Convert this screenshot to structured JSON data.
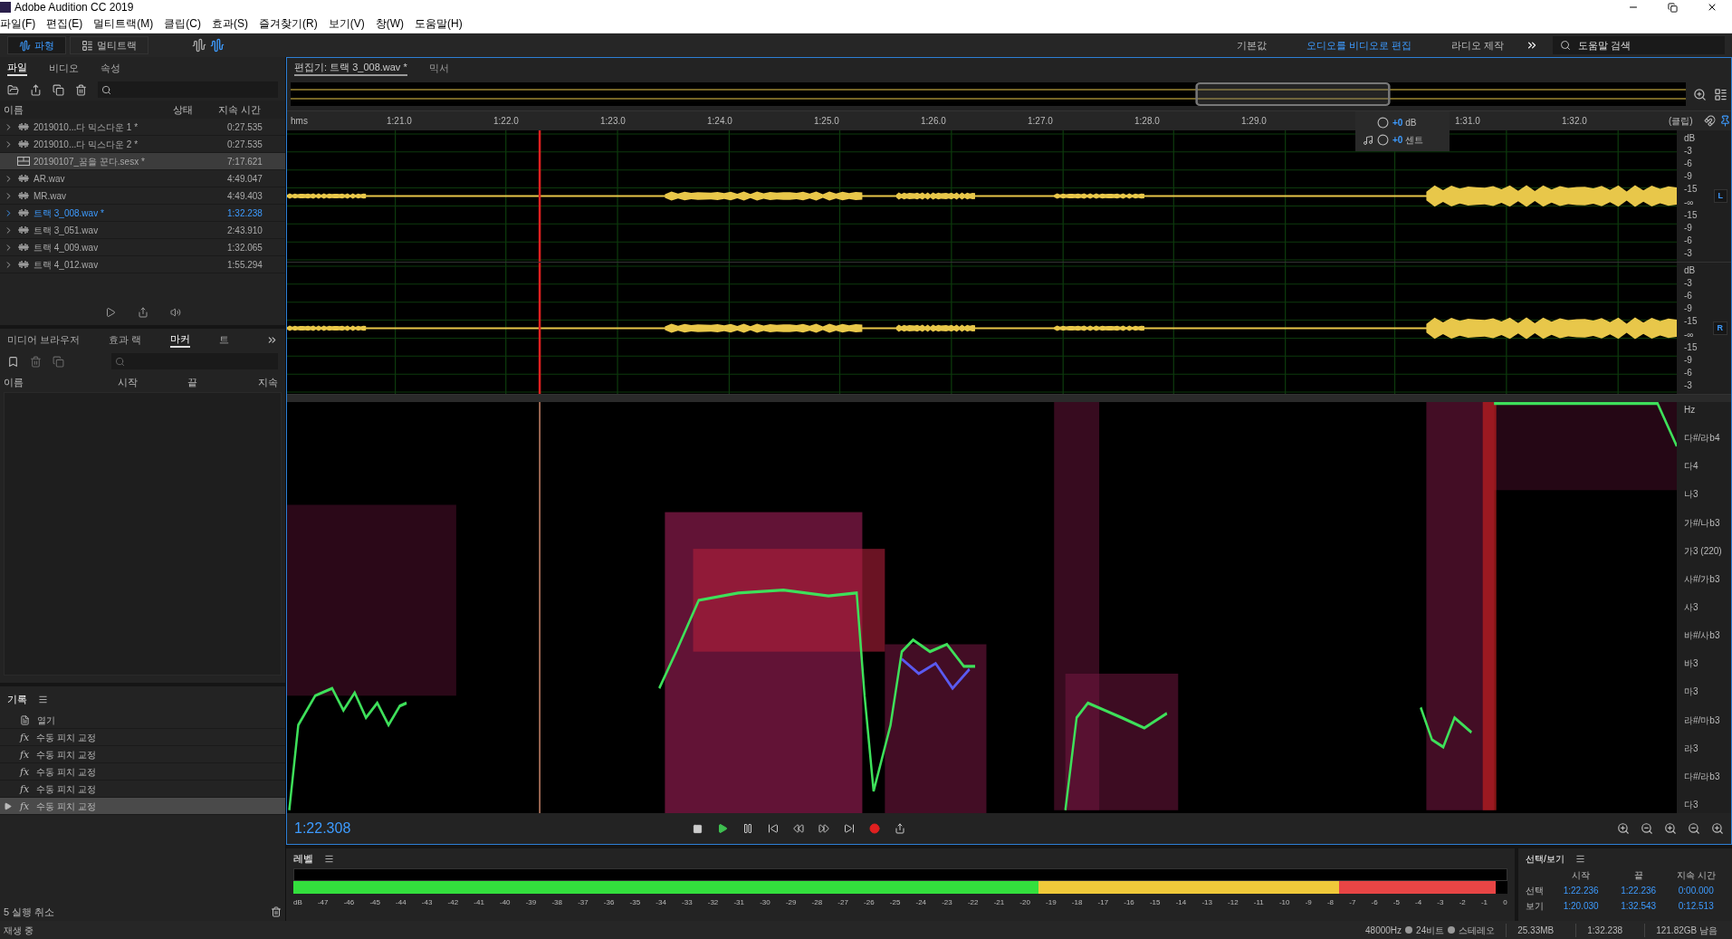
{
  "window": {
    "title": "Adobe Audition CC 2019"
  },
  "menu": [
    "파일(F)",
    "편집(E)",
    "멀티트랙(M)",
    "클립(C)",
    "효과(S)",
    "즐겨찾기(R)",
    "보기(V)",
    "창(W)",
    "도움말(H)"
  ],
  "modes": [
    {
      "label": "파형",
      "kind": "waveform",
      "selected": true
    },
    {
      "label": "멀티트랙",
      "kind": "multitrack",
      "selected": false
    }
  ],
  "workspaces": [
    {
      "label": "기본값",
      "selected": false
    },
    {
      "label": "오디오를 비디오로 편집",
      "selected": true
    },
    {
      "label": "라디오 제작",
      "selected": false
    }
  ],
  "help_search": {
    "placeholder": "도움말 검색"
  },
  "files_panel": {
    "tabs": [
      {
        "label": "파일",
        "selected": true
      },
      {
        "label": "비디오",
        "selected": false
      },
      {
        "label": "속성",
        "selected": false
      }
    ],
    "columns": [
      "이름",
      "상태",
      "지속 시간"
    ],
    "rows": [
      {
        "name": "2019010...다 믹스다운 1 *",
        "duration": "0:27.535",
        "kind": "audio",
        "selected": false,
        "open": false
      },
      {
        "name": "2019010...다 믹스다운 2 *",
        "duration": "0:27.535",
        "kind": "audio",
        "selected": false,
        "open": false
      },
      {
        "name": "20190107_꿈을 꾼다.sesx *",
        "duration": "7:17.621",
        "kind": "session",
        "selected": true,
        "open": false
      },
      {
        "name": "AR.wav",
        "duration": "4:49.047",
        "kind": "audio",
        "selected": false,
        "open": false
      },
      {
        "name": "MR.wav",
        "duration": "4:49.403",
        "kind": "audio",
        "selected": false,
        "open": false
      },
      {
        "name": "트랙 3_008.wav *",
        "duration": "1:32.238",
        "kind": "audio",
        "selected": false,
        "open": true
      },
      {
        "name": "트랙 3_051.wav",
        "duration": "2:43.910",
        "kind": "audio",
        "selected": false,
        "open": false
      },
      {
        "name": "트랙 4_009.wav",
        "duration": "1:32.065",
        "kind": "audio",
        "selected": false,
        "open": false
      },
      {
        "name": "트랙 4_012.wav",
        "duration": "1:55.294",
        "kind": "audio",
        "selected": false,
        "open": false
      }
    ]
  },
  "marker_panel": {
    "tabs": [
      {
        "label": "미디어 브라우저",
        "selected": false
      },
      {
        "label": "효과 랙",
        "selected": false
      },
      {
        "label": "마커",
        "selected": true
      },
      {
        "label": "트",
        "selected": false
      }
    ],
    "columns": [
      "이름",
      "시작",
      "끝",
      "지속"
    ]
  },
  "history_panel": {
    "title": "기록",
    "items": [
      {
        "label": "열기",
        "kind": "open",
        "current": false
      },
      {
        "label": "수동 피치 교정",
        "kind": "fx",
        "icon": "fx",
        "current": false
      },
      {
        "label": "수동 피치 교정",
        "kind": "fx",
        "icon": "fx",
        "current": false
      },
      {
        "label": "수동 피치 교정",
        "kind": "fx",
        "icon": "fx",
        "current": false
      },
      {
        "label": "수동 피치 교정",
        "kind": "fx",
        "icon": "fx",
        "current": false
      },
      {
        "label": "수동 피치 교정",
        "kind": "fx",
        "icon": "fx",
        "current": true
      }
    ],
    "undo_count": "5 실행 취소"
  },
  "status": "재생 중",
  "editor": {
    "tabs": [
      {
        "label": "편집기: 트랙 3_008.wav *",
        "selected": true
      },
      {
        "label": "믹서",
        "selected": false
      }
    ],
    "ruler": [
      "hms",
      "1:21.0",
      "1:22.0",
      "1:23.0",
      "1:24.0",
      "1:25.0",
      "1:26.0",
      "1:27.0",
      "1:28.0",
      "1:29.0",
      "1:31.0",
      "1:32.0"
    ],
    "ruler_end": "(클립)",
    "hud": {
      "volume": "+0",
      "volume_unit": "dB",
      "pitch": "+0",
      "pitch_unit": "센트"
    },
    "channels": [
      {
        "label": "L",
        "scale": [
          "dB",
          "-3",
          "-6",
          "-9",
          "-15",
          "-∞",
          "-15",
          "-9",
          "-6",
          "-3"
        ]
      },
      {
        "label": "R",
        "scale": [
          "dB",
          "-3",
          "-6",
          "-9",
          "-15",
          "-∞",
          "-15",
          "-9",
          "-6",
          "-3"
        ]
      }
    ],
    "pitch_scale": [
      "Hz",
      "다#/라b4",
      "다4",
      "나3",
      "가#/나b3",
      "가3 (220)",
      "사#/가b3",
      "사3",
      "바#/사b3",
      "바3",
      "마3",
      "라#/마b3",
      "라3",
      "다#/라b3",
      "다3"
    ],
    "time": "1:22.308"
  },
  "level_panel": {
    "title": "레벨",
    "level": 0.99,
    "scale": [
      "dB",
      "-47",
      "-46",
      "-45",
      "-44",
      "-43",
      "-42",
      "-41",
      "-40",
      "-39",
      "-38",
      "-37",
      "-36",
      "-35",
      "-34",
      "-33",
      "-32",
      "-31",
      "-30",
      "-29",
      "-28",
      "-27",
      "-26",
      "-25",
      "-24",
      "-23",
      "-22",
      "-21",
      "-20",
      "-19",
      "-18",
      "-17",
      "-16",
      "-15",
      "-14",
      "-13",
      "-12",
      "-11",
      "-10",
      "-9",
      "-8",
      "-7",
      "-6",
      "-5",
      "-4",
      "-3",
      "-2",
      "-1",
      "0"
    ]
  },
  "selection_panel": {
    "title": "선택/보기",
    "columns": [
      "시작",
      "끝",
      "지속 시간"
    ],
    "rows": [
      {
        "label": "선택",
        "values": [
          "1:22.236",
          "1:22.236",
          "0:00.000"
        ]
      },
      {
        "label": "보기",
        "values": [
          "1:20.030",
          "1:32.543",
          "0:12.513"
        ]
      }
    ]
  },
  "status_bar": {
    "format": [
      "48000Hz",
      "24비트",
      "스테레오"
    ],
    "items": [
      "25.33MB",
      "1:32.238",
      "121.82GB 남음"
    ]
  }
}
